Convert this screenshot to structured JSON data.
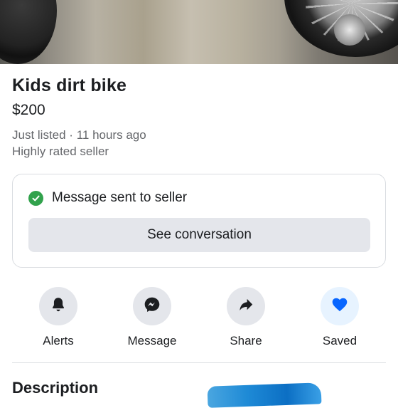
{
  "listing": {
    "title": "Kids dirt bike",
    "price": "$200",
    "listed_time": "Just listed · 11 hours ago",
    "seller_badge": "Highly rated seller"
  },
  "message_card": {
    "status_text": "Message sent to seller",
    "button_label": "See conversation",
    "status_color": "#31a24c"
  },
  "actions": [
    {
      "label": "Alerts",
      "icon": "bell-icon"
    },
    {
      "label": "Message",
      "icon": "messenger-icon"
    },
    {
      "label": "Share",
      "icon": "share-arrow-icon"
    },
    {
      "label": "Saved",
      "icon": "heart-icon"
    }
  ],
  "description": {
    "heading": "Description"
  },
  "colors": {
    "accent": "#0866ff",
    "button_bg": "#e4e6eb",
    "secondary_text": "#65676b"
  }
}
